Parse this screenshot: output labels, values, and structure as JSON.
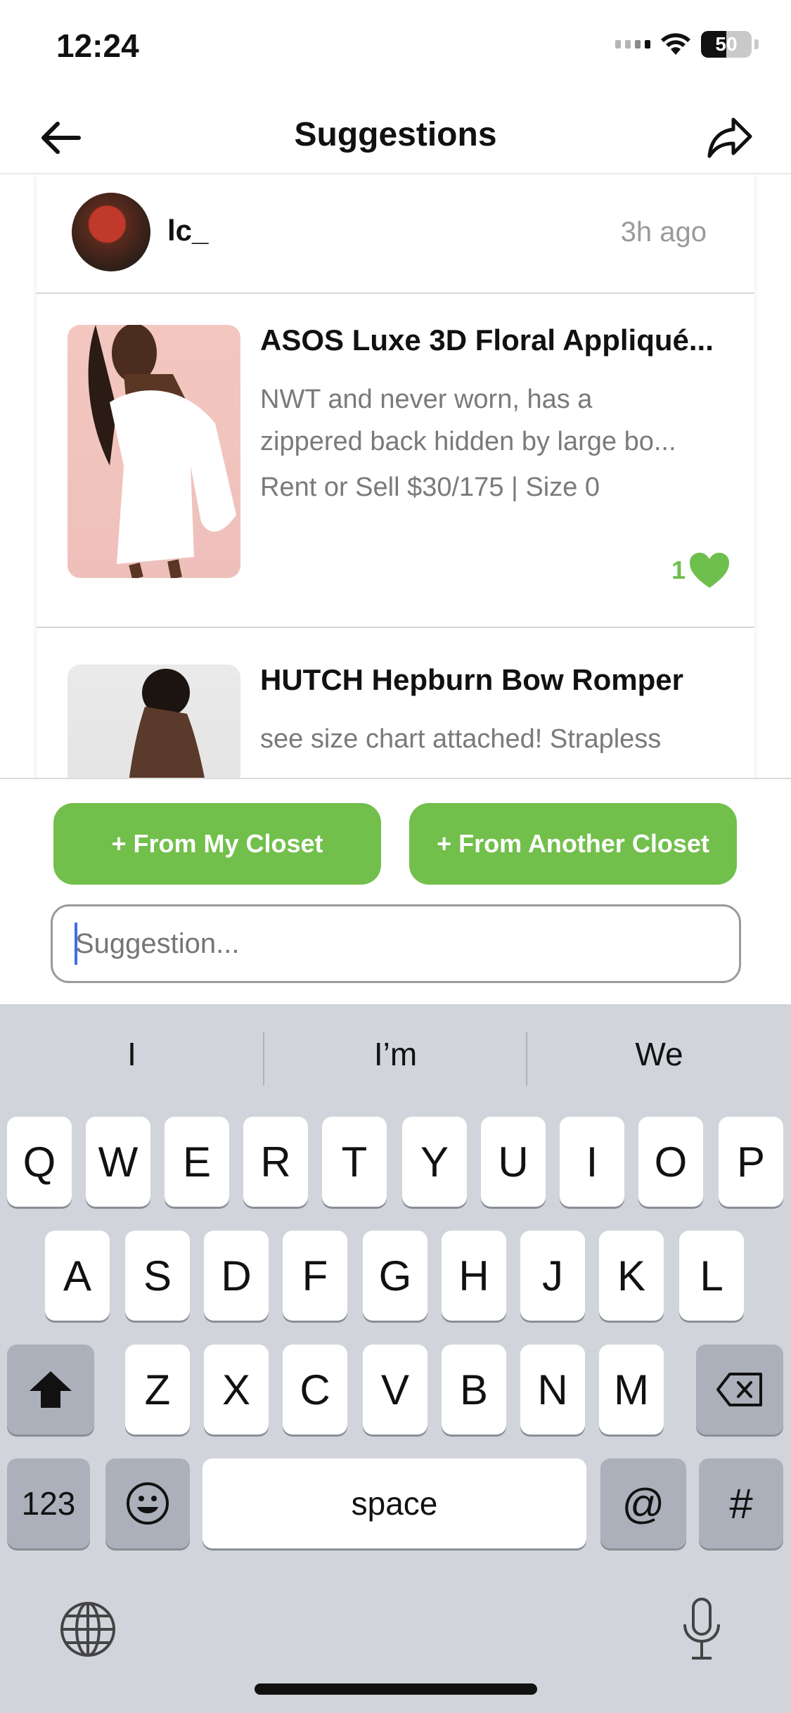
{
  "status_bar": {
    "time": "12:24",
    "battery": "50"
  },
  "header": {
    "title": "Suggestions"
  },
  "post": {
    "username": "lc_",
    "time_ago": "3h ago"
  },
  "items": [
    {
      "title": "ASOS Luxe 3D Floral Appliqué...",
      "desc_lines": [
        "NWT and never worn, has a",
        "zippered back hidden by large bo..."
      ],
      "price": "Rent or Sell $30/175 | Size 0",
      "likes": "1"
    },
    {
      "title": "HUTCH Hepburn Bow Romper",
      "desc_lines": [
        "see size chart attached! Strapless"
      ]
    }
  ],
  "actions": {
    "from_my_closet": "+ From My Closet",
    "from_another_closet": "+ From Another Closet",
    "suggestion_placeholder": "Suggestion..."
  },
  "keyboard": {
    "suggestions": [
      "I",
      "I’m",
      "We"
    ],
    "row1": [
      "Q",
      "W",
      "E",
      "R",
      "T",
      "Y",
      "U",
      "I",
      "O",
      "P"
    ],
    "row2": [
      "A",
      "S",
      "D",
      "F",
      "G",
      "H",
      "J",
      "K",
      "L"
    ],
    "row3": [
      "Z",
      "X",
      "C",
      "V",
      "B",
      "N",
      "M"
    ],
    "numbers_key": "123",
    "space_key": "space",
    "at_key": "@",
    "hash_key": "#"
  },
  "colors": {
    "accent_green": "#72bf4c",
    "like_green": "#6fbf4e"
  }
}
